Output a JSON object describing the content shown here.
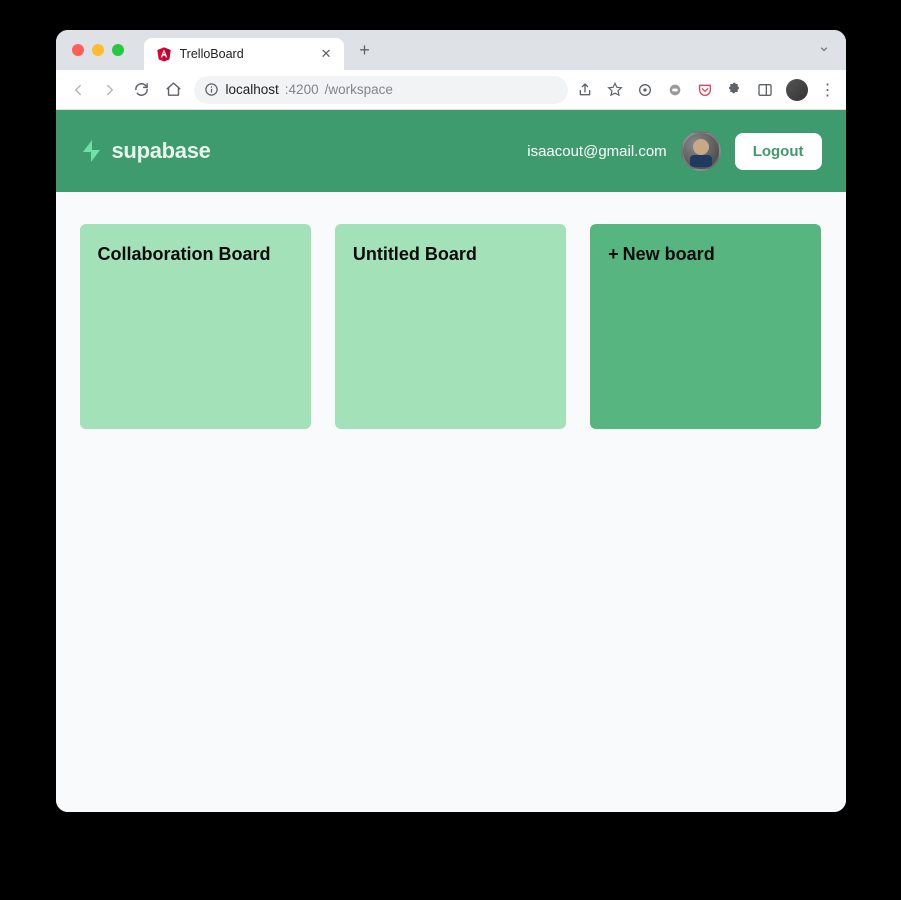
{
  "browser": {
    "tab_title": "TrelloBoard",
    "url_host": "localhost",
    "url_port": ":4200",
    "url_path": "/workspace"
  },
  "app": {
    "brand": "supabase",
    "user_email": "isaacout@gmail.com",
    "logout_label": "Logout"
  },
  "boards": [
    {
      "title": "Collaboration Board"
    },
    {
      "title": "Untitled Board"
    }
  ],
  "new_board": {
    "prefix": "+",
    "label": "New board"
  }
}
